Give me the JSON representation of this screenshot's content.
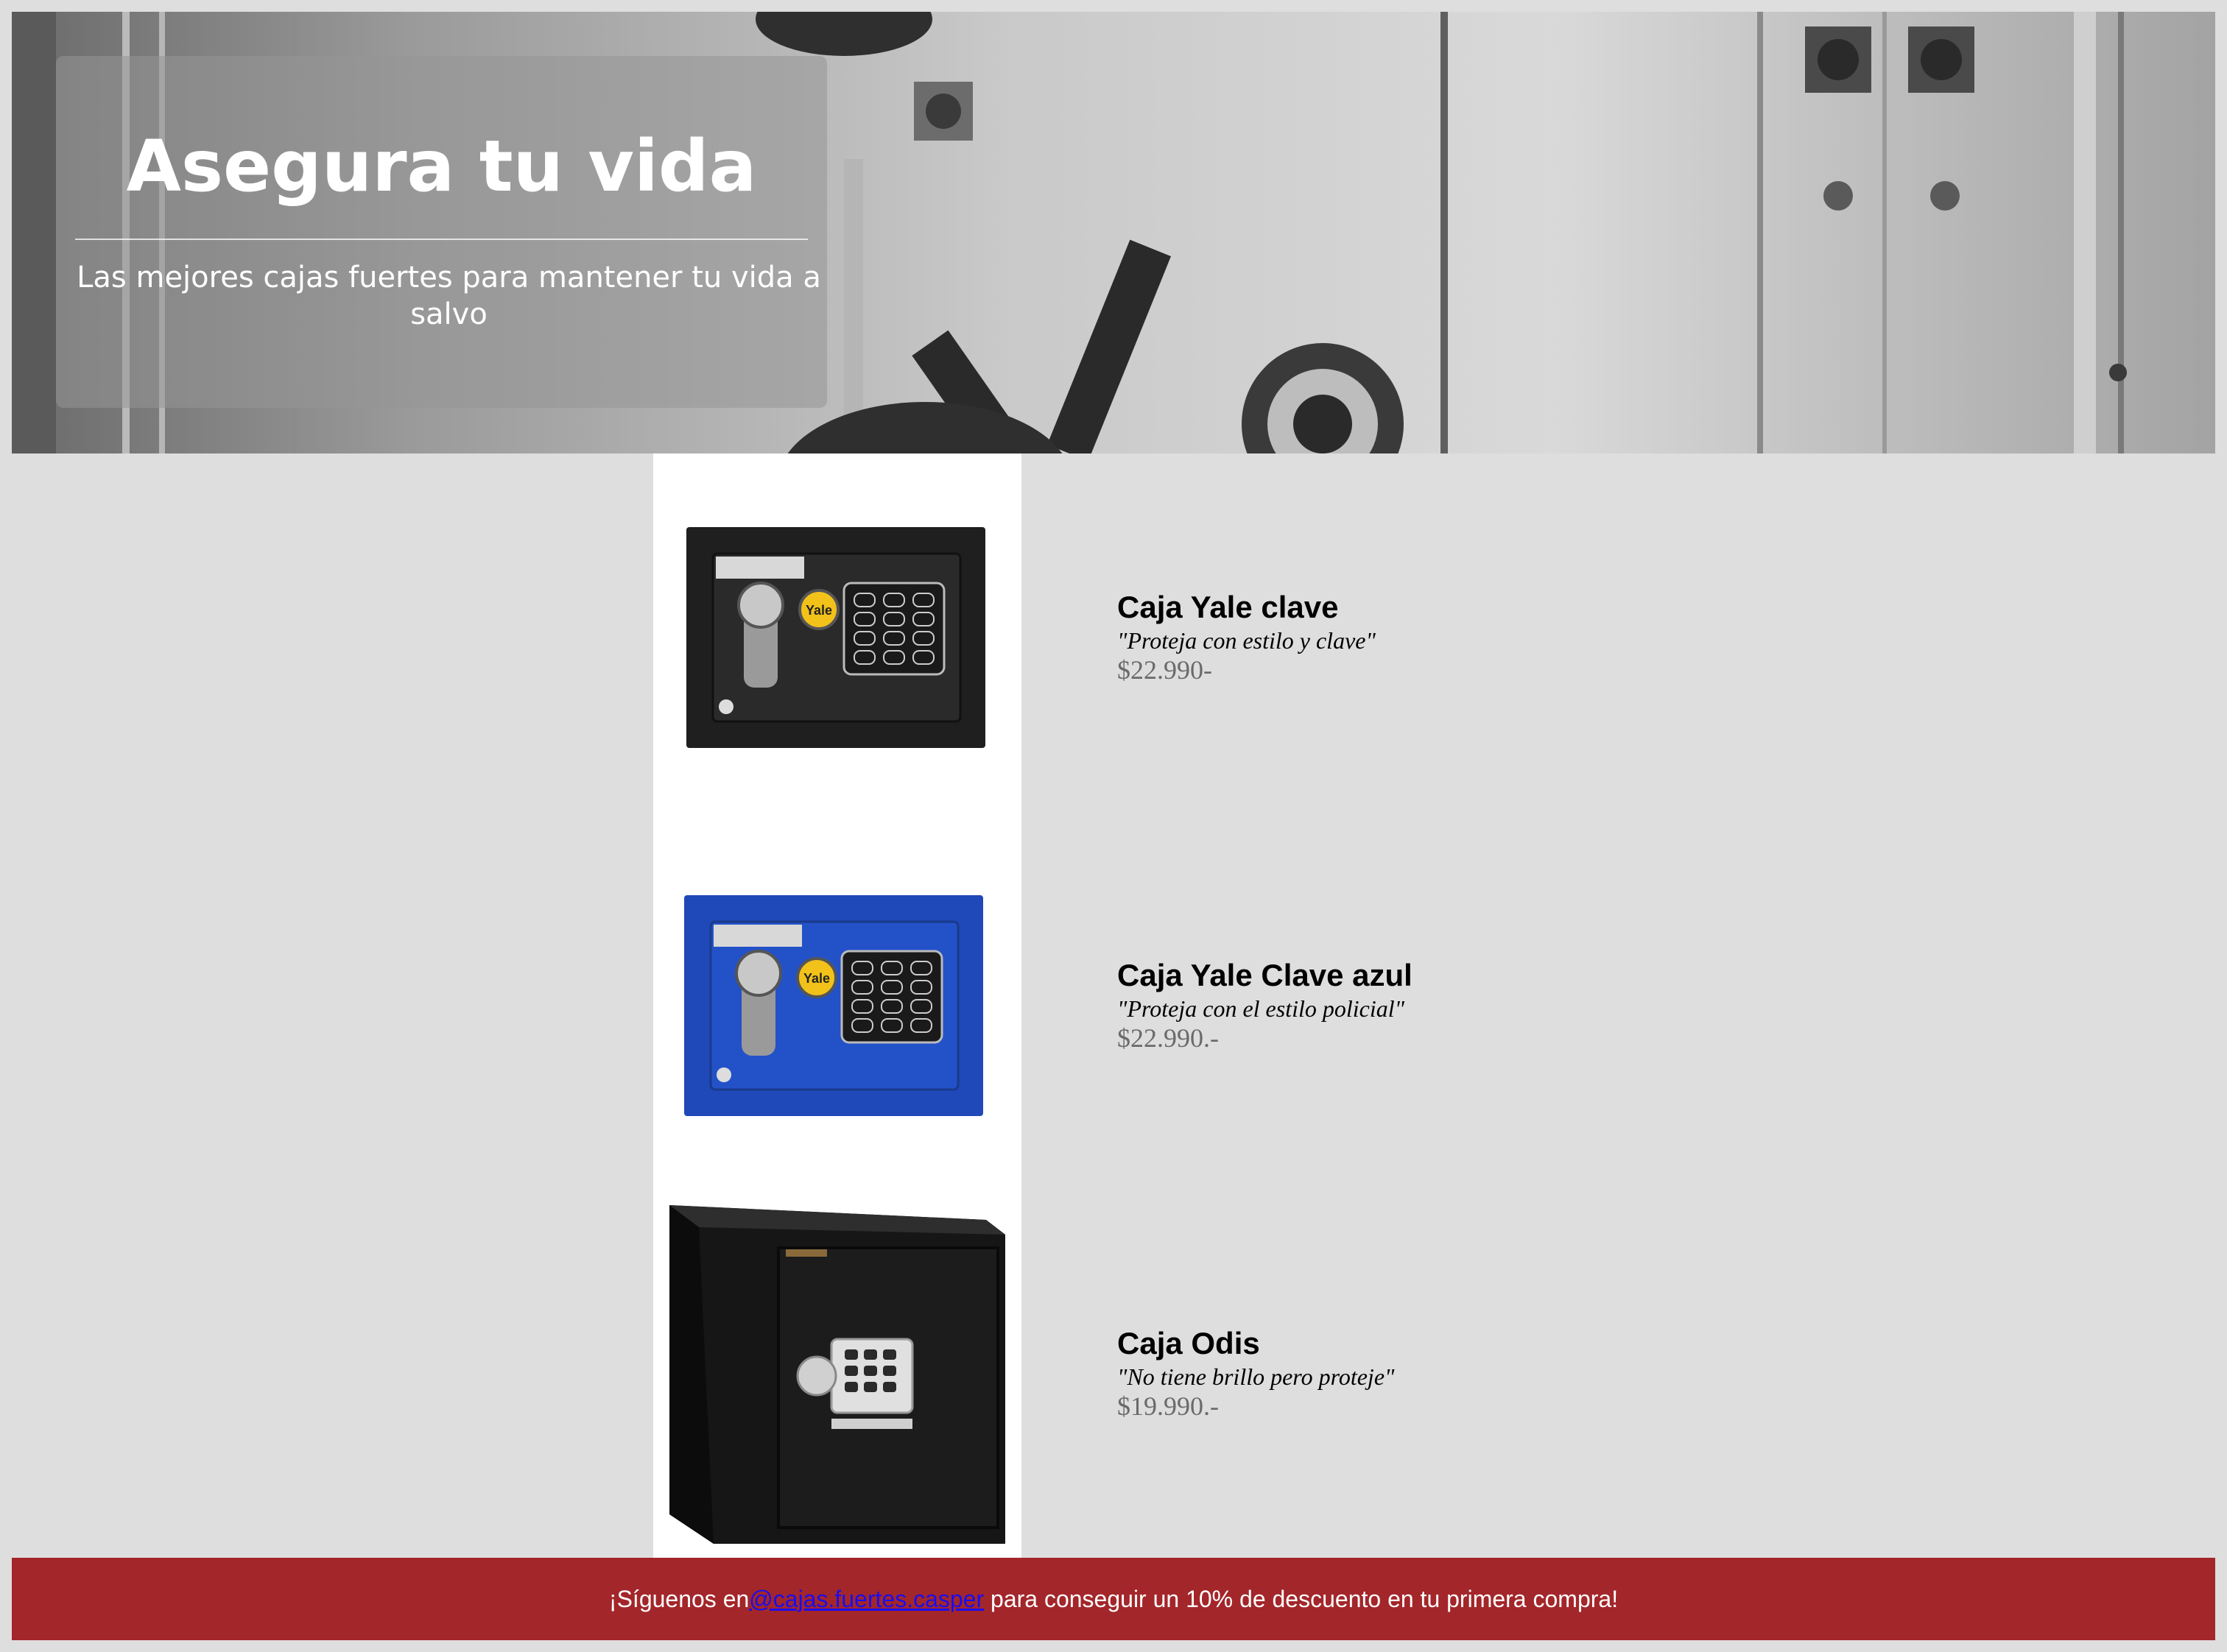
{
  "hero": {
    "title": "Asegura tu vida",
    "subtitle": "Las mejores cajas fuertes para mantener tu vida a salvo"
  },
  "products": [
    {
      "name": "Caja Yale clave",
      "slogan": "\"Proteja con estilo y clave\"",
      "price": "$22.990-",
      "brand_badge": "Yale",
      "color": "#1f1f1f"
    },
    {
      "name": "Caja Yale Clave azul",
      "slogan": "\"Proteja con el estilo policial\"",
      "price": "$22.990.-",
      "brand_badge": "Yale",
      "color": "#1f48b8"
    },
    {
      "name": "Caja Odis",
      "slogan": "\"No tiene brillo pero proteje\"",
      "price": "$19.990.-",
      "color": "#1a1a1a"
    }
  ],
  "footer": {
    "text_before": "¡Síguenos en",
    "link_text": "@cajas.fuertes.casper",
    "text_after": " para conseguir un 10% de descuento en tu primera compra!",
    "background": "#a3262a"
  }
}
